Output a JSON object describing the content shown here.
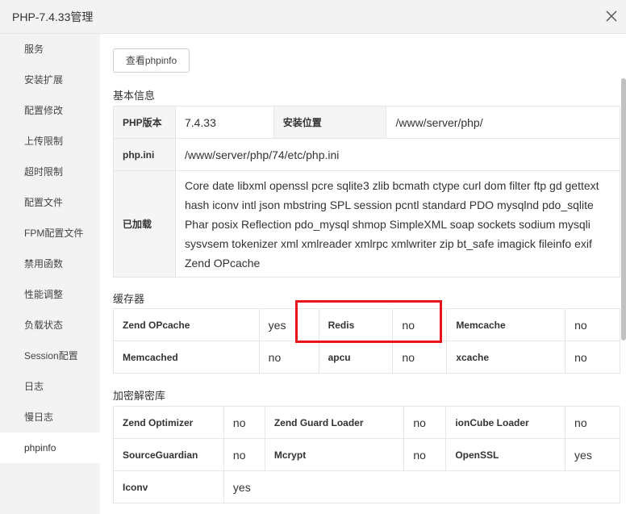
{
  "window": {
    "title": "PHP-7.4.33管理"
  },
  "sidebar": {
    "items": [
      {
        "label": "服务"
      },
      {
        "label": "安装扩展"
      },
      {
        "label": "配置修改"
      },
      {
        "label": "上传限制"
      },
      {
        "label": "超时限制"
      },
      {
        "label": "配置文件"
      },
      {
        "label": "FPM配置文件"
      },
      {
        "label": "禁用函数"
      },
      {
        "label": "性能调整"
      },
      {
        "label": "负载状态"
      },
      {
        "label": "Session配置"
      },
      {
        "label": "日志"
      },
      {
        "label": "慢日志"
      },
      {
        "label": "phpinfo"
      }
    ],
    "active": "phpinfo"
  },
  "toolbar": {
    "view_phpinfo_label": "查看phpinfo"
  },
  "basic": {
    "title": "基本信息",
    "php_version_label": "PHP版本",
    "php_version": "7.4.33",
    "install_path_label": "安装位置",
    "install_path": "/www/server/php/",
    "php_ini_label": "php.ini",
    "php_ini": "/www/server/php/74/etc/php.ini",
    "loaded_label": "已加载",
    "loaded": "Core date libxml openssl pcre sqlite3 zlib bcmath ctype curl dom filter ftp gd gettext hash iconv intl json mbstring SPL session pcntl standard PDO mysqlnd pdo_sqlite Phar posix Reflection pdo_mysql shmop SimpleXML soap sockets sodium mysqli sysvsem tokenizer xml xmlreader xmlrpc xmlwriter zip bt_safe imagick fileinfo exif Zend OPcache"
  },
  "cache": {
    "title": "缓存器",
    "rows": [
      [
        {
          "name": "Zend OPcache",
          "value": "yes"
        },
        {
          "name": "Redis",
          "value": "no"
        },
        {
          "name": "Memcache",
          "value": "no"
        }
      ],
      [
        {
          "name": "Memcached",
          "value": "no"
        },
        {
          "name": "apcu",
          "value": "no"
        },
        {
          "name": "xcache",
          "value": "no"
        }
      ]
    ]
  },
  "crypto": {
    "title": "加密解密库",
    "rows": [
      [
        {
          "name": "Zend Optimizer",
          "value": "no"
        },
        {
          "name": "Zend Guard Loader",
          "value": "no"
        },
        {
          "name": "ionCube Loader",
          "value": "no"
        }
      ],
      [
        {
          "name": "SourceGuardian",
          "value": "no"
        },
        {
          "name": "Mcrypt",
          "value": "no"
        },
        {
          "name": "OpenSSL",
          "value": "yes"
        }
      ],
      [
        {
          "name": "Iconv",
          "value": "yes"
        }
      ]
    ]
  },
  "colors": {
    "yes": "#20a53a",
    "no": "#e51c23",
    "highlight": "#e8141a"
  }
}
